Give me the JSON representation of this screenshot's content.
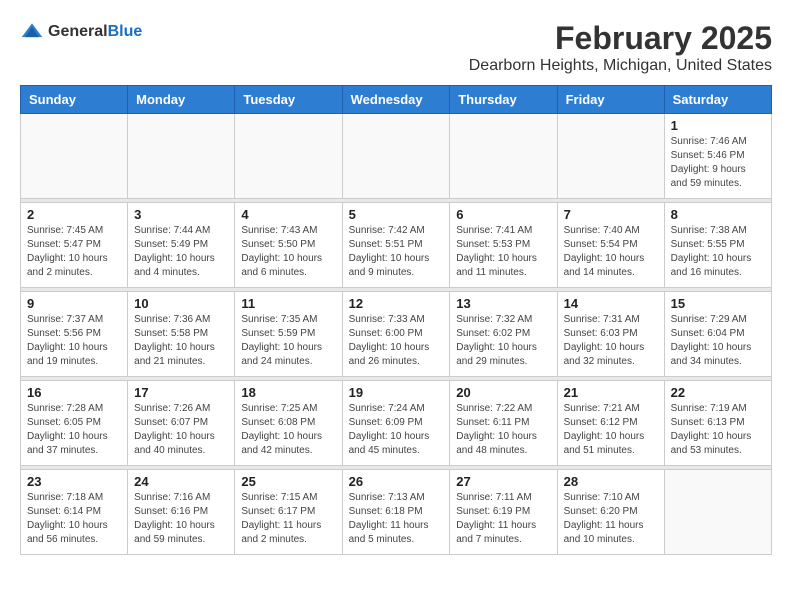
{
  "header": {
    "logo": {
      "general": "General",
      "blue": "Blue"
    },
    "title": "February 2025",
    "location": "Dearborn Heights, Michigan, United States"
  },
  "weekdays": [
    "Sunday",
    "Monday",
    "Tuesday",
    "Wednesday",
    "Thursday",
    "Friday",
    "Saturday"
  ],
  "weeks": [
    [
      {
        "day": "",
        "info": ""
      },
      {
        "day": "",
        "info": ""
      },
      {
        "day": "",
        "info": ""
      },
      {
        "day": "",
        "info": ""
      },
      {
        "day": "",
        "info": ""
      },
      {
        "day": "",
        "info": ""
      },
      {
        "day": "1",
        "info": "Sunrise: 7:46 AM\nSunset: 5:46 PM\nDaylight: 9 hours and 59 minutes."
      }
    ],
    [
      {
        "day": "2",
        "info": "Sunrise: 7:45 AM\nSunset: 5:47 PM\nDaylight: 10 hours and 2 minutes."
      },
      {
        "day": "3",
        "info": "Sunrise: 7:44 AM\nSunset: 5:49 PM\nDaylight: 10 hours and 4 minutes."
      },
      {
        "day": "4",
        "info": "Sunrise: 7:43 AM\nSunset: 5:50 PM\nDaylight: 10 hours and 6 minutes."
      },
      {
        "day": "5",
        "info": "Sunrise: 7:42 AM\nSunset: 5:51 PM\nDaylight: 10 hours and 9 minutes."
      },
      {
        "day": "6",
        "info": "Sunrise: 7:41 AM\nSunset: 5:53 PM\nDaylight: 10 hours and 11 minutes."
      },
      {
        "day": "7",
        "info": "Sunrise: 7:40 AM\nSunset: 5:54 PM\nDaylight: 10 hours and 14 minutes."
      },
      {
        "day": "8",
        "info": "Sunrise: 7:38 AM\nSunset: 5:55 PM\nDaylight: 10 hours and 16 minutes."
      }
    ],
    [
      {
        "day": "9",
        "info": "Sunrise: 7:37 AM\nSunset: 5:56 PM\nDaylight: 10 hours and 19 minutes."
      },
      {
        "day": "10",
        "info": "Sunrise: 7:36 AM\nSunset: 5:58 PM\nDaylight: 10 hours and 21 minutes."
      },
      {
        "day": "11",
        "info": "Sunrise: 7:35 AM\nSunset: 5:59 PM\nDaylight: 10 hours and 24 minutes."
      },
      {
        "day": "12",
        "info": "Sunrise: 7:33 AM\nSunset: 6:00 PM\nDaylight: 10 hours and 26 minutes."
      },
      {
        "day": "13",
        "info": "Sunrise: 7:32 AM\nSunset: 6:02 PM\nDaylight: 10 hours and 29 minutes."
      },
      {
        "day": "14",
        "info": "Sunrise: 7:31 AM\nSunset: 6:03 PM\nDaylight: 10 hours and 32 minutes."
      },
      {
        "day": "15",
        "info": "Sunrise: 7:29 AM\nSunset: 6:04 PM\nDaylight: 10 hours and 34 minutes."
      }
    ],
    [
      {
        "day": "16",
        "info": "Sunrise: 7:28 AM\nSunset: 6:05 PM\nDaylight: 10 hours and 37 minutes."
      },
      {
        "day": "17",
        "info": "Sunrise: 7:26 AM\nSunset: 6:07 PM\nDaylight: 10 hours and 40 minutes."
      },
      {
        "day": "18",
        "info": "Sunrise: 7:25 AM\nSunset: 6:08 PM\nDaylight: 10 hours and 42 minutes."
      },
      {
        "day": "19",
        "info": "Sunrise: 7:24 AM\nSunset: 6:09 PM\nDaylight: 10 hours and 45 minutes."
      },
      {
        "day": "20",
        "info": "Sunrise: 7:22 AM\nSunset: 6:11 PM\nDaylight: 10 hours and 48 minutes."
      },
      {
        "day": "21",
        "info": "Sunrise: 7:21 AM\nSunset: 6:12 PM\nDaylight: 10 hours and 51 minutes."
      },
      {
        "day": "22",
        "info": "Sunrise: 7:19 AM\nSunset: 6:13 PM\nDaylight: 10 hours and 53 minutes."
      }
    ],
    [
      {
        "day": "23",
        "info": "Sunrise: 7:18 AM\nSunset: 6:14 PM\nDaylight: 10 hours and 56 minutes."
      },
      {
        "day": "24",
        "info": "Sunrise: 7:16 AM\nSunset: 6:16 PM\nDaylight: 10 hours and 59 minutes."
      },
      {
        "day": "25",
        "info": "Sunrise: 7:15 AM\nSunset: 6:17 PM\nDaylight: 11 hours and 2 minutes."
      },
      {
        "day": "26",
        "info": "Sunrise: 7:13 AM\nSunset: 6:18 PM\nDaylight: 11 hours and 5 minutes."
      },
      {
        "day": "27",
        "info": "Sunrise: 7:11 AM\nSunset: 6:19 PM\nDaylight: 11 hours and 7 minutes."
      },
      {
        "day": "28",
        "info": "Sunrise: 7:10 AM\nSunset: 6:20 PM\nDaylight: 11 hours and 10 minutes."
      },
      {
        "day": "",
        "info": ""
      }
    ]
  ]
}
